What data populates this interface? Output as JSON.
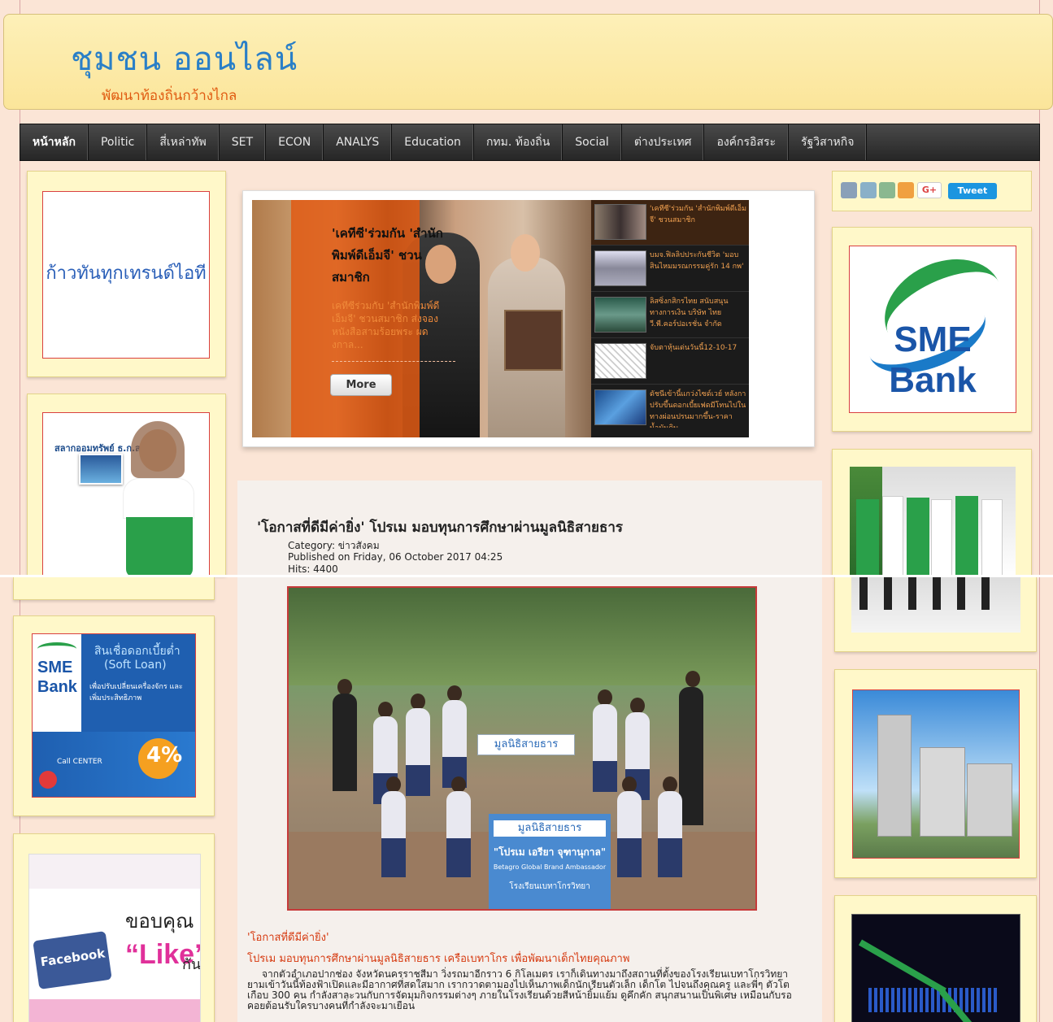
{
  "header": {
    "site_title": "ชุมชน ออนไลน์",
    "tagline": "พัฒนาท้องถิ่นกว้างไกล"
  },
  "nav": {
    "items": [
      "หน้าหลัก",
      "Politic",
      "สี่เหล่าทัพ",
      "SET",
      "ECON",
      "ANALYS",
      "Education",
      "กทม. ท้องถิ่น",
      "Social",
      "ต่างประเทศ",
      "องค์กรอิสระ",
      "รัฐวิสาหกิจ"
    ]
  },
  "left_banners": {
    "trend_text": "ก้าวทันทุกเทรนด์ไอที",
    "lottery_text": "สลากออมทรัพย์ ธ.ก.ส.",
    "soft_loan": {
      "title": "สินเชื่อดอกเบี้ยต่ำ",
      "subtitle": "(Soft Loan)",
      "desc": "เพื่อปรับเปลี่ยนเครื่องจักร และเพิ่มประสิทธิภาพ",
      "bank": "SME",
      "bank2": "Bank",
      "percent": "4%",
      "call": "Call CENTER"
    },
    "facebook": {
      "thanks": "ขอบคุณ",
      "like": "“Like”",
      "suffix": "กัน",
      "fb": "Facebook"
    }
  },
  "slider": {
    "main_title": "'เคทีซี'ร่วมกัน 'สำนักพิมพ์ดีเอ็มจี' ชวนสมาชิก",
    "main_desc": "เคทีซีร่วมกับ 'สำนักพิมพ์ดีเอ็มจี' ชวนสมาชิก ส่งจอง หนังสือสามร้อยพระ ผดงกาล...",
    "more_label": "More",
    "items": [
      "'เคทีซี'ร่วมกัน 'สำนักพิมพ์ดีเอ็มจี' ชวนสมาชิก",
      "บมจ.ฟิลลิปประกันชีวิต 'มอบสินไหมมรณกรรมคู่รัก 14 กพ'",
      "ลิสซิ่งกสิกรไทย สนับสนุนทางการเงิน บริษัท ไทย วี.พี.คอร์ปอเรชั่น จำกัด",
      "จับตาหุ้นเด่นวันนี้12-10-17",
      "ดัชนีเข้านี้แกว่งไซด์เวย์ หลังกาปรับขึ้นดอกเบี้ยเฟดมีโทนไปในทางผ่อนปรนมากขึ้น-ราคาน้ำมันดิบ"
    ]
  },
  "article": {
    "title": "'โอกาสที่ดีมีค่ายิ่ง' โปรเม มอบทุนการศึกษาผ่านมูลนิธิสายธาร",
    "category": "Category: ข่าวสังคม",
    "published": "Published on Friday, 06 October 2017 04:25",
    "hits": "Hits: 4400",
    "photo_sign1": "มูลนิธิสายธาร",
    "photo_sign2": "มูลนิธิสายธาร",
    "photo_caption": "\"โปรเม เอรียา จุฑานุกาล\"",
    "photo_caption2": "Betagro Global Brand Ambassador",
    "photo_caption3": "โรงเรียนเบทาโกรวิทยา",
    "sub1": "'โอกาสที่ดีมีค่ายิ่ง'",
    "sub2": "โปรเม มอบทุนการศึกษาผ่านมูลนิธิสายธาร เครือเบทาโกร เพื่อพัฒนาเด็กไทยคุณภาพ",
    "body": "จากตัวอำเภอปากช่อง จังหวัดนครราชสีมา วิ่งรถมาอีกราว 6 กิโลเมตร เราก็เดินทางมาถึงสถานที่ตั้งของโรงเรียนเบทาโกรวิทยา ยามเข้าวันนี้ท้องฟ้าเปิดและมีอากาศที่สดใสมาก เรากวาดตามองไปเห็นภาพเด็กนักเรียนตัวเล็ก เด็กโต ไปจนถึงคุณครู และพี่ๆ ตัวโต เกือบ 300 คน กำลังสาละวนกับการจัดมุมกิจกรรมต่างๆ ภายในโรงเรียนด้วยสีหน้ายิ้มแย้ม ดูคึกคัก สนุกสนานเป็นพิเศษ เหมือนกับรอคอยต้อนรับใครบางคนที่กำลังจะมาเยือน"
  },
  "right": {
    "tweet_label": "Tweet",
    "gplus_label": "G+",
    "sme_bank": "SME Bank"
  },
  "colors": {
    "page_bg": "#fbe5d6",
    "header_bg": "#fdf0b8",
    "title_blue": "#2a7fc7",
    "tagline_orange": "#e05a10",
    "nav_bg": "#2f2f2f",
    "accent_red": "#d63a10"
  }
}
